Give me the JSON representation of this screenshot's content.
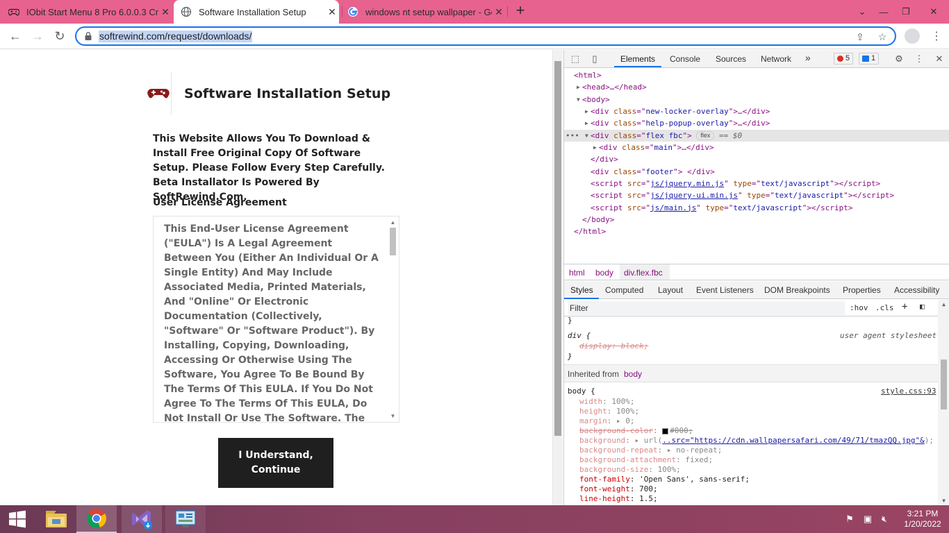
{
  "browser": {
    "tabs": [
      {
        "title": "IObit Start Menu 8 Pro 6.0.0.3 Cr",
        "icon": "gamepad-icon"
      },
      {
        "title": "Software Installation Setup",
        "icon": "globe-icon",
        "active": true
      },
      {
        "title": "windows nt setup wallpaper - Go",
        "icon": "google-icon"
      }
    ],
    "address": "softrewind.com/request/downloads/"
  },
  "page": {
    "site_title": "Software Installation Setup",
    "intro": "This Website Allows You To Download & Install Free Original Copy Of Software Setup. Please Follow Every Step Carefully. Beta Installator Is Powered By SoftRewind.Com.",
    "eula_heading": "User License Agreement",
    "eula_text": "This End-User License Agreement (\"EULA\") Is A Legal Agreement Between You (Either An Individual Or A Single Entity) And May Include Associated Media, Printed Materials, And \"Online\" Or Electronic Documentation (Collectively, \"Software\" Or \"Software Product\"). By Installing, Copying, Downloading, Accessing Or Otherwise Using The Software, You Agree To Be Bound By The Terms Of This EULA. If You Do Not Agree To The Terms Of This EULA, Do Not Install Or Use The Software. The Software Is Protected By Copyright Laws And International Copyright Treaties, As Well As",
    "continue_label": "I Understand, Continue"
  },
  "devtools": {
    "tabs": [
      "Elements",
      "Console",
      "Sources",
      "Network"
    ],
    "more": "»",
    "errors": "5",
    "messages": "1",
    "dom": {
      "html_open": "<html>",
      "head": "<head>…</head>",
      "body_open": "<body>",
      "div1_class": "new-locker-overlay",
      "div2_class": "help-popup-overlay",
      "div3_class": "flex fbc",
      "div3_badge": "flex",
      "div3_eq": "== $0",
      "div_main_class": "main",
      "div_close": "</div>",
      "footer_class": "footer",
      "script1_src": "js/jquery.min.js",
      "script2_src": "js/jquery-ui.min.js",
      "script3_src": "js/main.js",
      "script_type": "text/javascript",
      "body_close": "</body>",
      "html_close": "</html>"
    },
    "breadcrumbs": [
      "html",
      "body",
      "div.flex.fbc"
    ],
    "panel_tabs": [
      "Styles",
      "Computed",
      "Layout",
      "Event Listeners",
      "DOM Breakpoints",
      "Properties",
      "Accessibility"
    ],
    "filter_placeholder": "Filter",
    "hov": ":hov",
    "cls": ".cls",
    "styles": {
      "brace_close": "}",
      "ua_selector": "div {",
      "ua_source": "user agent stylesheet",
      "ua_prop": "display: block;",
      "inherited_label": "Inherited from",
      "inherited_from": "body",
      "body_selector": "body {",
      "body_source": "style.css:93",
      "props": [
        {
          "name": "width",
          "value": "100%;",
          "dim": true
        },
        {
          "name": "height",
          "value": "100%;",
          "dim": true
        },
        {
          "name": "margin",
          "value": "▸ 0;",
          "dim": true
        },
        {
          "name": "background-color",
          "value": "#000;",
          "dim": true,
          "strike": true
        },
        {
          "name": "background",
          "value": "▸ url(",
          "dim": true
        },
        {
          "name": "background-repeat",
          "value": "▸ no-repeat;",
          "dim": true
        },
        {
          "name": "background-attachment",
          "value": "fixed;",
          "dim": true
        },
        {
          "name": "background-size",
          "value": "100%;",
          "dim": true
        },
        {
          "name": "font-family",
          "value": "'Open Sans', sans-serif;",
          "dim": false
        },
        {
          "name": "font-weight",
          "value": "700;",
          "dim": false
        },
        {
          "name": "line-height",
          "value": "1.5;",
          "dim": false
        }
      ],
      "bg_url": "..src=\"https://cdn.wallpapersafari.com/49/71/tmazQQ.jpg\"&",
      "bg_url_close": ");"
    }
  },
  "taskbar": {
    "time": "3:21 PM",
    "date": "1/20/2022"
  }
}
